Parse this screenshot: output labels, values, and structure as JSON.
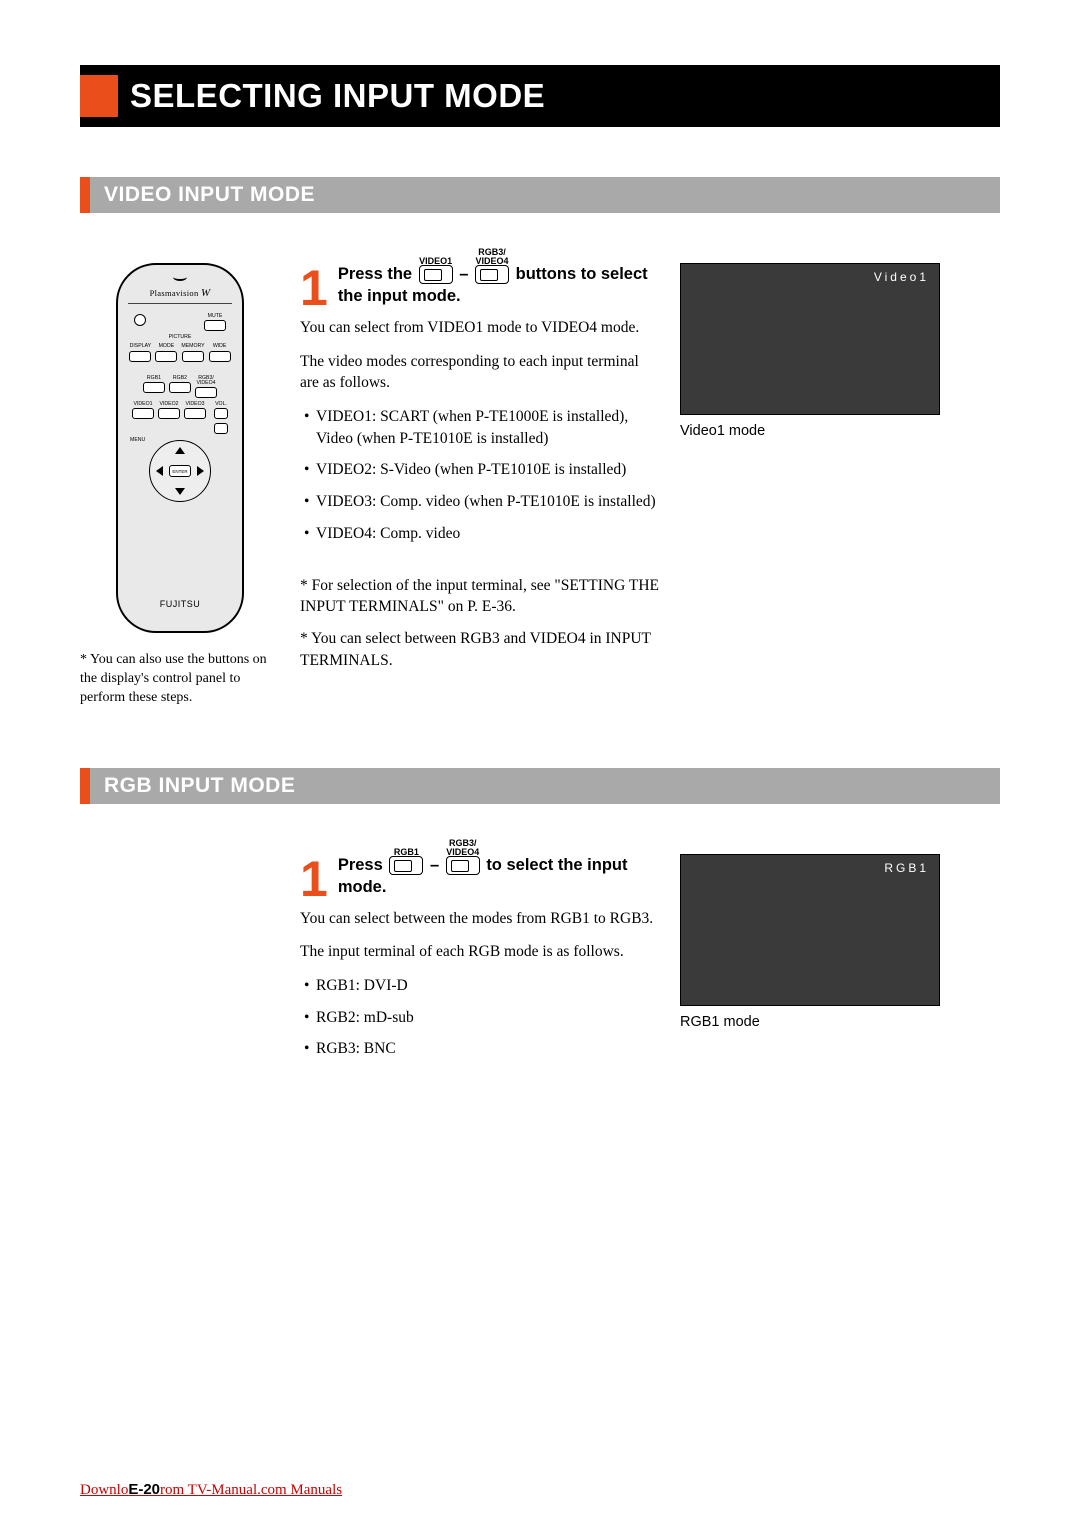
{
  "title": "SELECTING INPUT MODE",
  "section1": {
    "heading": "VIDEO INPUT MODE",
    "remote_brand": "Plasmavision",
    "remote_buttons": {
      "mute": "MUTE",
      "picture": "PICTURE",
      "display": "DISPLAY",
      "mode": "MODE",
      "memory": "MEMORY",
      "wide": "WIDE",
      "rgb1": "RGB1",
      "rgb2": "RGB2",
      "rgb3": "RGB3/\nVIDEO4",
      "video1": "VIDEO1",
      "video2": "VIDEO2",
      "video3": "VIDEO3",
      "vol": "VOL.",
      "menu": "MENU",
      "enter": "ENTER"
    },
    "remote_maker": "FUJITSU",
    "remote_note": "You can also use the buttons on the display's control panel to perform these steps.",
    "step_num": "1",
    "key1_sup": "VIDEO1",
    "key2_sup": "RGB3/\nVIDEO4",
    "head_a": "Press the ",
    "head_b": " – ",
    "head_c": " buttons to select the input mode.",
    "p1": "You can select from VIDEO1 mode to VIDEO4 mode.",
    "p2": "The video modes corresponding to each input terminal are as follows.",
    "bullets": [
      "VIDEO1:  SCART (when P-TE1000E is installed), Video (when P-TE1010E is installed)",
      "VIDEO2: S-Video (when P-TE1010E is installed)",
      "VIDEO3: Comp. video (when P-TE1010E is installed)",
      "VIDEO4: Comp. video"
    ],
    "notes": [
      "For selection of the input terminal, see \"SETTING THE INPUT TERMINALS\" on P. E-36.",
      "You can select between RGB3 and VIDEO4 in INPUT TERMINALS."
    ],
    "screen_text": "Video1",
    "screen_caption": "Video1 mode"
  },
  "section2": {
    "heading": "RGB INPUT MODE",
    "step_num": "1",
    "key1_sup": "RGB1",
    "key2_sup": "RGB3/\nVIDEO4",
    "head_a": "Press ",
    "head_b": " – ",
    "head_c": " to select the input mode.",
    "p1": "You can select between the modes from RGB1 to RGB3.",
    "p2": "The input terminal of each RGB mode is as follows.",
    "bullets": [
      "RGB1: DVI-D",
      "RGB2: mD-sub",
      "RGB3: BNC"
    ],
    "screen_text": "RGB1",
    "screen_caption": "RGB1 mode"
  },
  "footer": {
    "link_a": "Downlo",
    "page": "E-20",
    "link_b": "rom TV-Manual.com Manuals"
  }
}
